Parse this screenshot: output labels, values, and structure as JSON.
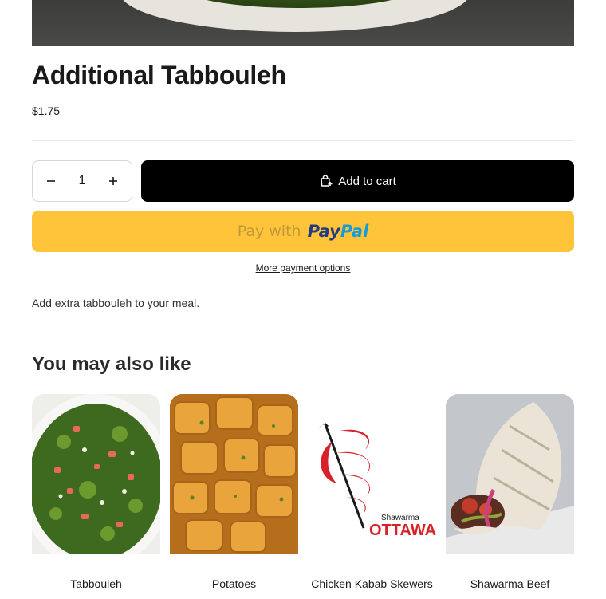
{
  "product": {
    "title": "Additional Tabbouleh",
    "price": "$1.75",
    "quantity": "1",
    "description": "Add extra tabbouleh to your meal."
  },
  "actions": {
    "add_to_cart": "Add to cart",
    "pay_with": "Pay with",
    "paypal_pay": "Pay",
    "paypal_pal": "Pal",
    "more_payment": "More payment options"
  },
  "recommendations": {
    "heading": "You may also like",
    "items": [
      {
        "name": "Tabbouleh"
      },
      {
        "name": "Potatoes"
      },
      {
        "name": "Chicken Kabab Skewers"
      },
      {
        "name": "Shawarma Beef"
      }
    ],
    "logo_text": {
      "top": "Shawarma",
      "bottom": "OTTAWA"
    }
  },
  "colors": {
    "paypal_yellow": "#ffc439",
    "paypal_dark_blue": "#253b80",
    "paypal_light_blue": "#179bd7",
    "logo_red": "#d8222a",
    "cart_button": "#000000"
  },
  "icons": [
    "minus-icon",
    "plus-icon",
    "cart-icon"
  ]
}
